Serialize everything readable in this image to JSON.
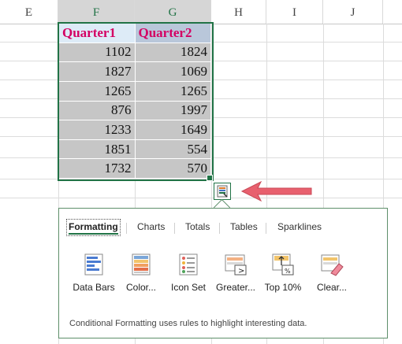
{
  "columns": [
    "E",
    "F",
    "G",
    "H",
    "I",
    "J"
  ],
  "table": {
    "headers": [
      "Quarter1",
      "Quarter2"
    ],
    "rows": [
      [
        "1102",
        "1824"
      ],
      [
        "1827",
        "1069"
      ],
      [
        "1265",
        "1265"
      ],
      [
        "876",
        "1997"
      ],
      [
        "1233",
        "1649"
      ],
      [
        "1851",
        "554"
      ],
      [
        "1732",
        "570"
      ]
    ]
  },
  "quick_analysis": {
    "tabs": [
      "Formatting",
      "Charts",
      "Totals",
      "Tables",
      "Sparklines"
    ],
    "active_tab": "Formatting",
    "options": [
      "Data Bars",
      "Color...",
      "Icon Set",
      "Greater...",
      "Top 10%",
      "Clear..."
    ],
    "hint": "Conditional Formatting uses rules to highlight interesting data."
  },
  "colors": {
    "accent": "#217346",
    "header_text": "#d40063",
    "arrow": "#e8606e",
    "cell_fill": "#c6c6c6"
  },
  "icons": [
    "quick-analysis-icon",
    "data-bars-icon",
    "color-scale-icon",
    "icon-set-icon",
    "greater-than-icon",
    "top-10-icon",
    "clear-format-icon"
  ]
}
